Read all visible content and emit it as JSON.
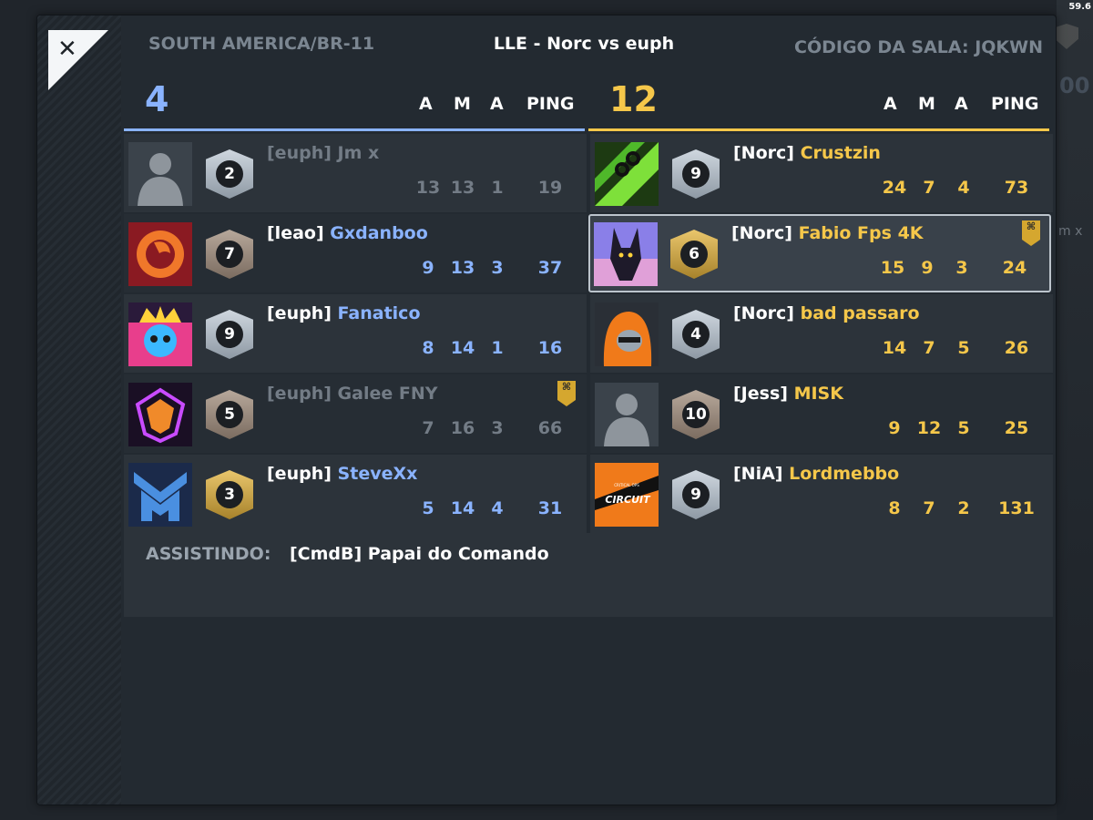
{
  "fps": "59.6",
  "header": {
    "region": "SOUTH AMERICA/BR-11",
    "title": "LLE - Norc vs euph",
    "room_label": "CÓDIGO DA SALA:",
    "room_code": "JQKWN"
  },
  "columns": {
    "c1": "A",
    "c2": "M",
    "c3": "A",
    "ping": "PING"
  },
  "team_blue": {
    "score": "4",
    "players": [
      {
        "tag": "[euph]",
        "name": "Jm x",
        "rank": "2",
        "a": "13",
        "m": "13",
        "as": "1",
        "ping": "19"
      },
      {
        "tag": "[leao]",
        "name": "Gxdanboo",
        "rank": "7",
        "a": "9",
        "m": "13",
        "as": "3",
        "ping": "37"
      },
      {
        "tag": "[euph]",
        "name": "Fanatico",
        "rank": "9",
        "a": "8",
        "m": "14",
        "as": "1",
        "ping": "16"
      },
      {
        "tag": "[euph]",
        "name": "Galee FNY",
        "rank": "5",
        "a": "7",
        "m": "16",
        "as": "3",
        "ping": "66"
      },
      {
        "tag": "[euph]",
        "name": "SteveXx",
        "rank": "3",
        "a": "5",
        "m": "14",
        "as": "4",
        "ping": "31"
      }
    ]
  },
  "team_gold": {
    "score": "12",
    "players": [
      {
        "tag": "[Norc]",
        "name": "Crustzin",
        "rank": "9",
        "a": "24",
        "m": "7",
        "as": "4",
        "ping": "73"
      },
      {
        "tag": "[Norc]",
        "name": "Fabio Fps 4K",
        "rank": "6",
        "a": "15",
        "m": "9",
        "as": "3",
        "ping": "24"
      },
      {
        "tag": "[Norc]",
        "name": "bad passaro",
        "rank": "4",
        "a": "14",
        "m": "7",
        "as": "5",
        "ping": "26"
      },
      {
        "tag": "[Jess]",
        "name": "MISK",
        "rank": "10",
        "a": "9",
        "m": "12",
        "as": "5",
        "ping": "25"
      },
      {
        "tag": "[NiA]",
        "name": "Lordmebbo",
        "rank": "9",
        "a": "8",
        "m": "7",
        "as": "2",
        "ping": "131"
      }
    ]
  },
  "spectators": {
    "label": "ASSISTINDO:",
    "name": "[CmdB] Papai do Comando"
  },
  "background": {
    "ghost_score": "00",
    "ghost_name": "m x"
  },
  "avatar_text": {
    "lordmebbo": "CIRCUIT",
    "lordmebbo_small": "CRITICAL OPS"
  },
  "colors": {
    "blue_team": "#8ab3ff",
    "gold_team": "#f5c74a",
    "badge": "#d5a72f"
  },
  "icons": {
    "close": "close-icon",
    "badge": "chevron-badge-icon"
  }
}
